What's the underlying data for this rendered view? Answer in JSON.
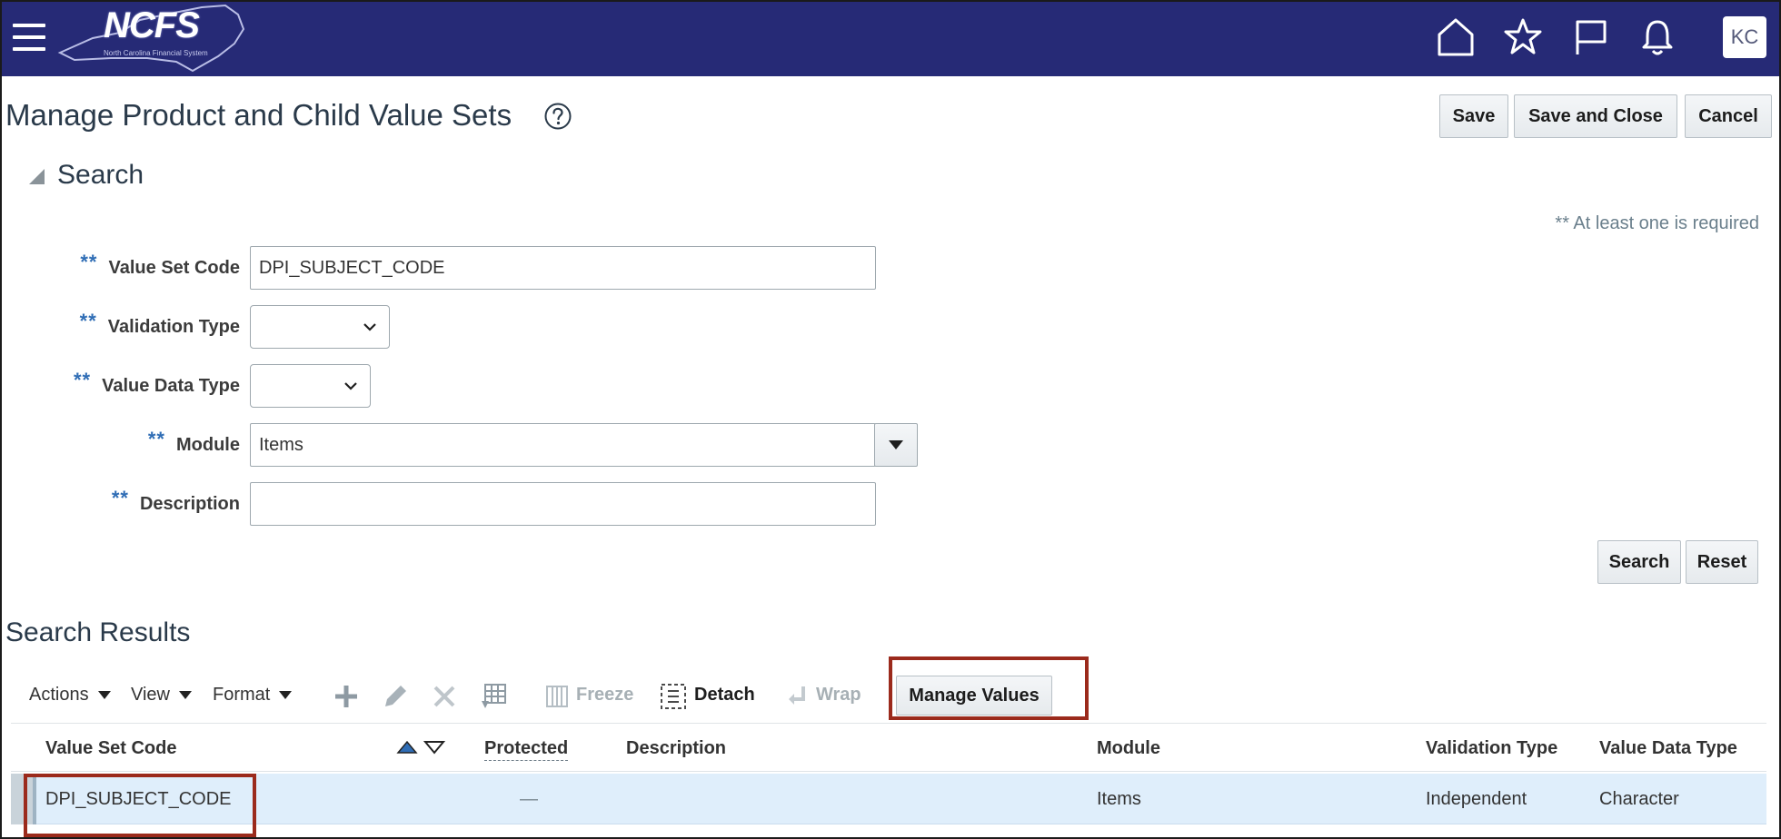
{
  "header": {
    "logo_text": "NCFS",
    "logo_subtext": "North Carolina Financial System",
    "avatar_initials": "KC",
    "brand_color": "#262a76",
    "icons": [
      "menu-icon",
      "home-icon",
      "favorites-star-icon",
      "flag-icon",
      "notifications-bell-icon"
    ]
  },
  "page": {
    "title": "Manage Product and Child Value Sets",
    "buttons": {
      "save": "Save",
      "save_and_close": "Save and Close",
      "cancel": "Cancel"
    }
  },
  "search": {
    "heading": "Search",
    "required_note": "** At least one is required",
    "required_marker": "**",
    "fields": {
      "value_set_code": {
        "label": "Value Set Code",
        "value": "DPI_SUBJECT_CODE"
      },
      "validation_type": {
        "label": "Validation Type",
        "value": ""
      },
      "value_data_type": {
        "label": "Value Data Type",
        "value": ""
      },
      "module": {
        "label": "Module",
        "value": "Items"
      },
      "description": {
        "label": "Description",
        "value": ""
      }
    },
    "buttons": {
      "search": "Search",
      "reset": "Reset"
    }
  },
  "results": {
    "title": "Search Results",
    "toolbar": {
      "actions": "Actions",
      "view": "View",
      "format": "Format",
      "freeze": "Freeze",
      "detach": "Detach",
      "wrap": "Wrap",
      "manage_values": "Manage Values"
    },
    "columns": [
      "Value Set Code",
      "Protected",
      "Description",
      "Module",
      "Validation Type",
      "Value Data Type"
    ],
    "rows": [
      {
        "value_set_code": "DPI_SUBJECT_CODE",
        "protected": "—",
        "description": "",
        "module": "Items",
        "validation_type": "Independent",
        "value_data_type": "Character"
      }
    ],
    "highlight_color": "#9b2a1c"
  }
}
